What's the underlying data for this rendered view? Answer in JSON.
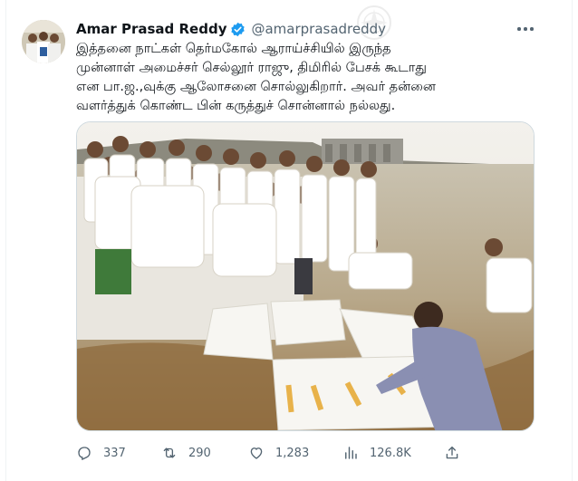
{
  "tweet": {
    "author": {
      "display_name": "Amar Prasad Reddy",
      "handle": "@amarprasadreddy",
      "verified": true
    },
    "text_lines": [
      "இத்தனை நாட்கள் தெர்மகோல் ஆராய்ச்சியில் இருந்த",
      "முன்னாள் அமைச்சர் செல்லூர் ராஜு, திமிரில் பேசக் கூடாது",
      "என பா.ஜ.,வுக்கு ஆலோசனை சொல்லுகிறார். அவர் தன்னை",
      "வளர்த்துக் கொண்ட பின் கருத்துச் சொன்னால் நல்லது."
    ],
    "stats": {
      "replies": "337",
      "retweets": "290",
      "likes": "1,283",
      "views": "126.8K"
    }
  },
  "icons": [
    "more-icon",
    "verified-badge-icon",
    "reply-icon",
    "retweet-icon",
    "like-icon",
    "views-icon",
    "share-icon"
  ],
  "colors": {
    "text": "#0f1419",
    "secondary": "#536471",
    "verified": "#1d9bf0",
    "border": "#cfd9de"
  }
}
